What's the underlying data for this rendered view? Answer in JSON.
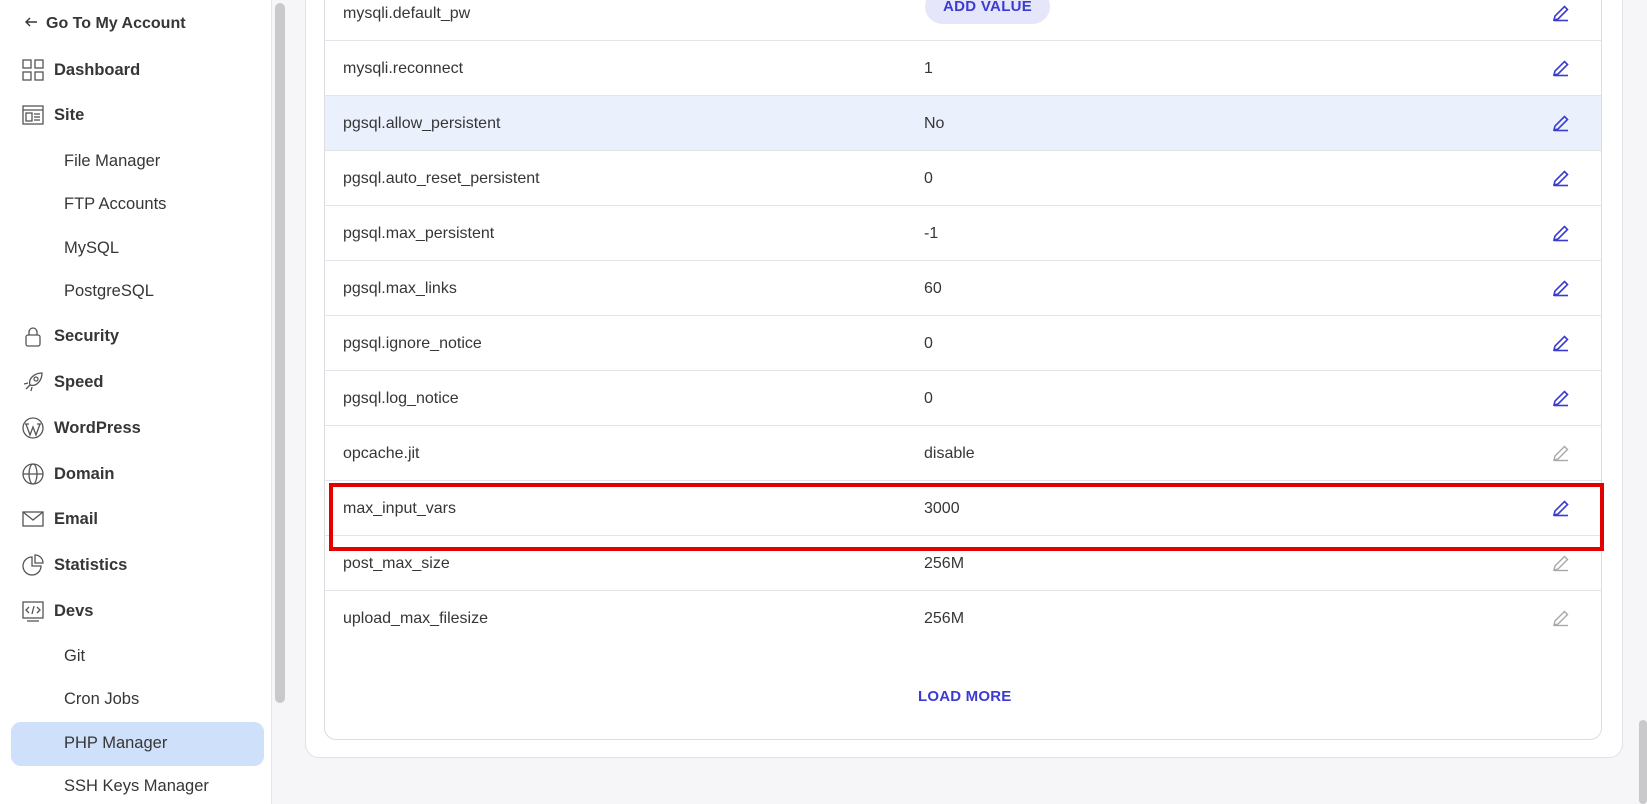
{
  "sidebar": {
    "back_label": "Go To My Account",
    "items": [
      {
        "label": "Dashboard",
        "icon": "dashboard-icon"
      },
      {
        "label": "Site",
        "icon": "site-icon"
      },
      {
        "label": "Security",
        "icon": "lock-icon"
      },
      {
        "label": "Speed",
        "icon": "rocket-icon"
      },
      {
        "label": "WordPress",
        "icon": "wordpress-icon"
      },
      {
        "label": "Domain",
        "icon": "globe-icon"
      },
      {
        "label": "Email",
        "icon": "envelope-icon"
      },
      {
        "label": "Statistics",
        "icon": "pie-chart-icon"
      },
      {
        "label": "Devs",
        "icon": "code-icon"
      }
    ],
    "site_sub": [
      "File Manager",
      "FTP Accounts",
      "MySQL",
      "PostgreSQL"
    ],
    "devs_sub": [
      "Git",
      "Cron Jobs",
      "PHP Manager",
      "SSH Keys Manager"
    ],
    "active": "PHP Manager"
  },
  "table": {
    "add_value_label": "ADD VALUE",
    "load_more_label": "LOAD MORE",
    "rows": [
      {
        "name": "mysqli.default_pw",
        "value": ""
      },
      {
        "name": "mysqli.reconnect",
        "value": "1"
      },
      {
        "name": "pgsql.allow_persistent",
        "value": "No"
      },
      {
        "name": "pgsql.auto_reset_persistent",
        "value": "0"
      },
      {
        "name": "pgsql.max_persistent",
        "value": "-1"
      },
      {
        "name": "pgsql.max_links",
        "value": "60"
      },
      {
        "name": "pgsql.ignore_notice",
        "value": "0"
      },
      {
        "name": "pgsql.log_notice",
        "value": "0"
      },
      {
        "name": "opcache.jit",
        "value": "disable"
      },
      {
        "name": "max_input_vars",
        "value": "3000"
      },
      {
        "name": "post_max_size",
        "value": "256M"
      },
      {
        "name": "upload_max_filesize",
        "value": "256M"
      }
    ]
  },
  "colors": {
    "accent": "#3b3bd1",
    "active_bg": "#cfe0fb",
    "highlight_row": "#eaf1fd",
    "annotation_red": "#e20000",
    "edit_disabled": "#a8a8a8"
  }
}
